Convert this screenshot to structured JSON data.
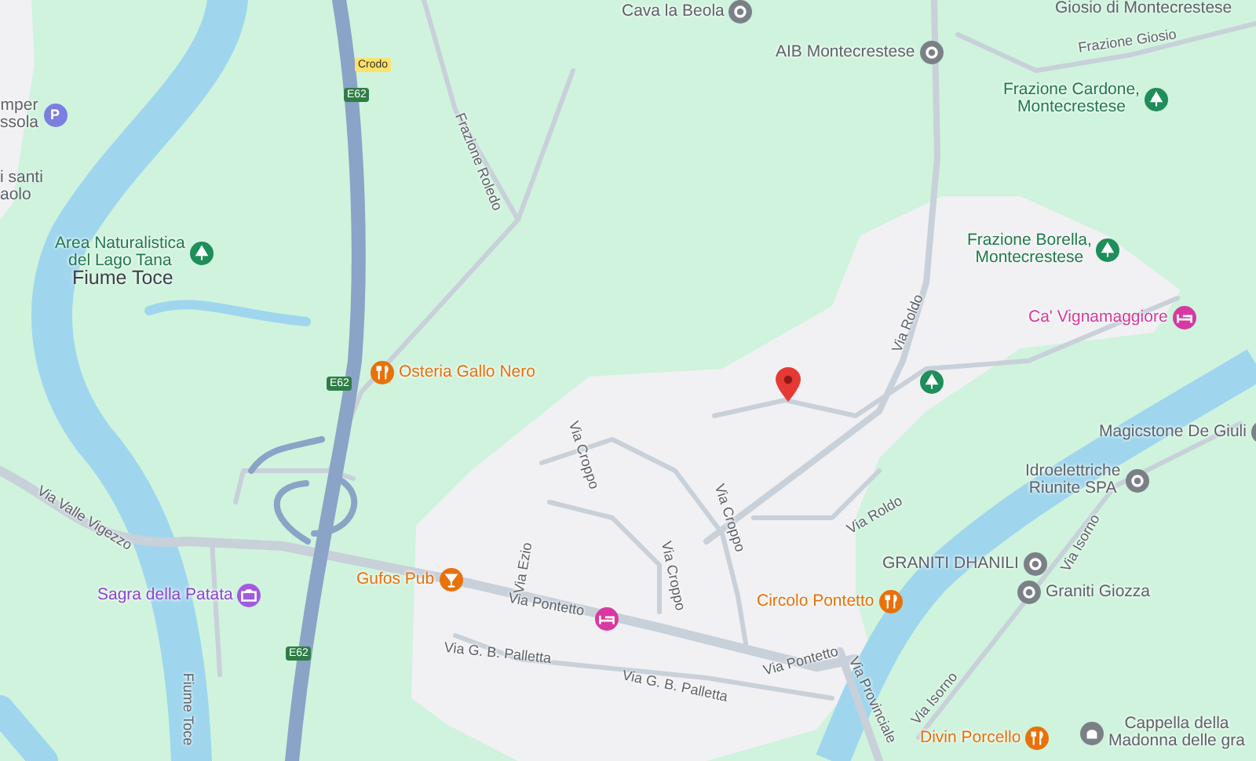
{
  "map": {
    "labels": [
      {
        "kind": "landmark",
        "lines": [
          "Cava la Beola"
        ]
      },
      {
        "kind": "place",
        "lines": [
          "Giosio di Montecrestese"
        ]
      },
      {
        "kind": "road",
        "text": "Frazione Giosio"
      },
      {
        "kind": "landmark",
        "lines": [
          "AIB Montecrestese"
        ]
      },
      {
        "kind": "park",
        "lines": [
          "Frazione Cardone,",
          "Montecrestese"
        ]
      },
      {
        "kind": "town",
        "text": "Crodo"
      },
      {
        "kind": "route",
        "text": "E62"
      },
      {
        "kind": "parking",
        "badge": "P",
        "lines": [
          "mper",
          "ssola"
        ]
      },
      {
        "kind": "road",
        "text": "Frazione Roledo"
      },
      {
        "kind": "place",
        "lines": [
          "i santi",
          "aolo"
        ]
      },
      {
        "kind": "park",
        "lines": [
          "Area Naturalistica",
          "del Lago Tana"
        ]
      },
      {
        "kind": "locality",
        "lines": [
          "Fiume Toce"
        ]
      },
      {
        "kind": "park",
        "lines": [
          "Frazione Borella,",
          "Montecrestese"
        ]
      },
      {
        "kind": "hotel",
        "lines": [
          "Ca' Vignamaggiore"
        ]
      },
      {
        "kind": "road",
        "text": "Via Roldo"
      },
      {
        "kind": "restaurant",
        "lines": [
          "Osteria Gallo Nero"
        ]
      },
      {
        "kind": "route",
        "text": "E62"
      },
      {
        "kind": "park"
      },
      {
        "kind": "pin"
      },
      {
        "kind": "landmark",
        "lines": [
          "Magicstone De Giuli"
        ]
      },
      {
        "kind": "road",
        "text": "Via Croppo"
      },
      {
        "kind": "landmark",
        "lines": [
          "Idroelettriche",
          "Riunite SPA"
        ]
      },
      {
        "kind": "road",
        "text": "Via Valle Vigezzo"
      },
      {
        "kind": "road",
        "text": "Via Croppo"
      },
      {
        "kind": "road",
        "text": "Via Roldo"
      },
      {
        "kind": "road",
        "text": "Via Isorno"
      },
      {
        "kind": "landmark",
        "lines": [
          "GRANITI DHANILI"
        ]
      },
      {
        "kind": "road",
        "text": "Via Ezio"
      },
      {
        "kind": "road",
        "text": "Via Croppo"
      },
      {
        "kind": "bar",
        "lines": [
          "Gufos Pub"
        ]
      },
      {
        "kind": "landmark",
        "lines": [
          "Graniti Giozza"
        ]
      },
      {
        "kind": "event",
        "lines": [
          "Sagra della Patata"
        ]
      },
      {
        "kind": "restaurant",
        "lines": [
          "Circolo Pontetto"
        ]
      },
      {
        "kind": "road",
        "text": "Via Pontetto"
      },
      {
        "kind": "hotel"
      },
      {
        "kind": "road",
        "text": "Via G. B. Palletta"
      },
      {
        "kind": "route",
        "text": "E62"
      },
      {
        "kind": "road",
        "text": "Via Pontetto"
      },
      {
        "kind": "road",
        "text": "Via G. B. Palletta"
      },
      {
        "kind": "road",
        "text": "Via Provinciale"
      },
      {
        "kind": "road",
        "text": "Via Isorno"
      },
      {
        "kind": "road",
        "text": "Fiume Toce"
      },
      {
        "kind": "restaurant",
        "lines": [
          "Divin Porcello"
        ]
      },
      {
        "kind": "chapel",
        "lines": [
          "Cappella della",
          "Madonna delle gra"
        ]
      }
    ]
  }
}
